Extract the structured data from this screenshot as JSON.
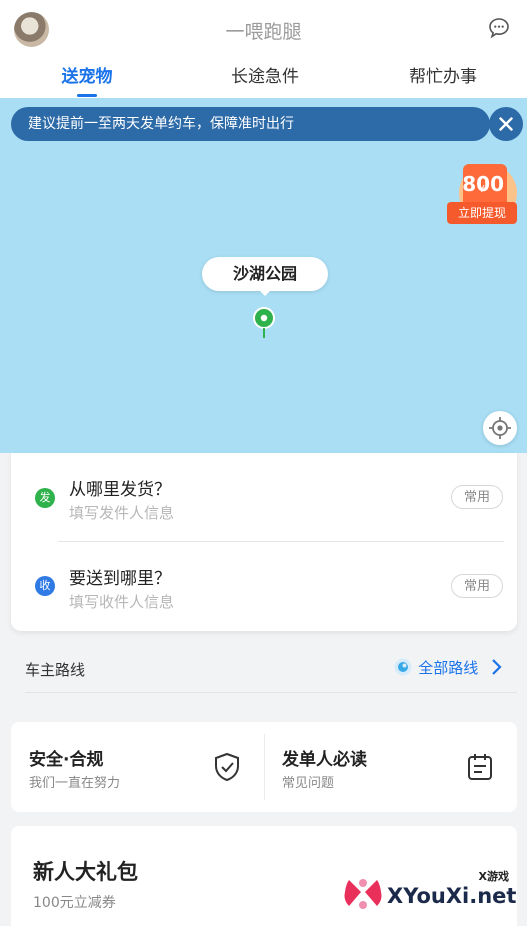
{
  "header": {
    "app_title": "一喂跑腿",
    "tabs": [
      {
        "label": "送宠物",
        "active": true
      },
      {
        "label": "长途急件",
        "active": false
      },
      {
        "label": "帮忙办事",
        "active": false
      }
    ]
  },
  "map": {
    "notice": "建议提前一至两天发单约车，保障准时出行",
    "coupon": {
      "currency": "¥",
      "amount": "800",
      "cta": "立即提现"
    },
    "place_label": "沙湖公园"
  },
  "address": {
    "from": {
      "badge": "发",
      "title": "从哪里发货？",
      "subtitle": "填写发件人信息",
      "chip": "常用"
    },
    "to": {
      "badge": "收",
      "title": "要送到哪里？",
      "subtitle": "填写收件人信息",
      "chip": "常用"
    }
  },
  "routes": {
    "label": "车主路线",
    "link": "全部路线"
  },
  "info": {
    "safety": {
      "title": "安全·合规",
      "subtitle": "我们一直在努力"
    },
    "guide": {
      "title": "发单人必读",
      "subtitle": "常见问题"
    }
  },
  "gift": {
    "title": "新人大礼包",
    "subtitle": "100元立减券"
  },
  "watermark": {
    "small": "X游戏",
    "brand": "XYouXi.net"
  },
  "colors": {
    "accent": "#1a73e8",
    "map_water": "#a9def4",
    "notice_bg": "#2d6aa8",
    "from_badge": "#2fb24b",
    "to_badge": "#2f7ae5",
    "coupon": "#f55a2c"
  }
}
